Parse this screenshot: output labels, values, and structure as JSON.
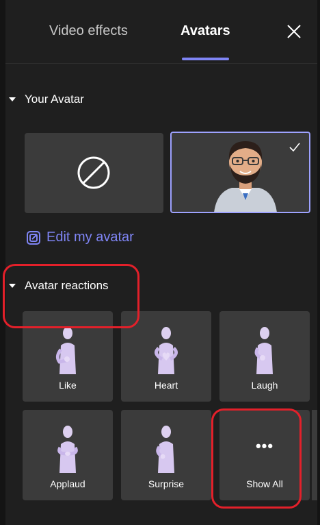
{
  "tabs": {
    "video_effects": "Video effects",
    "avatars": "Avatars"
  },
  "sections": {
    "your_avatar": "Your Avatar",
    "avatar_reactions": "Avatar reactions"
  },
  "edit_link": "Edit my avatar",
  "reactions": {
    "like": "Like",
    "heart": "Heart",
    "laugh": "Laugh",
    "applaud": "Applaud",
    "surprise": "Surprise",
    "show_all": "Show All",
    "show_all_glyph": "•••"
  },
  "icons": {
    "close": "close-icon",
    "caret": "caret-down-icon",
    "none": "prohibited-icon",
    "check": "checkmark-icon",
    "edit": "open-external-icon"
  },
  "colors": {
    "accent": "#7f85f5",
    "selected_border": "#9ea2ff",
    "annotation": "#e3202a",
    "tile_bg": "#3b3b3b",
    "panel_bg": "#1f1f1f"
  }
}
